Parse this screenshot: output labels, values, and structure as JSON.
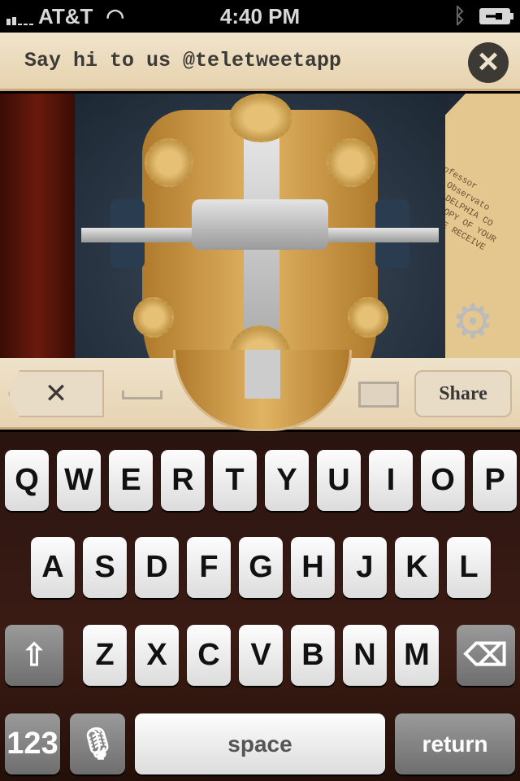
{
  "status": {
    "carrier": "AT&T",
    "time": "4:40 PM"
  },
  "banner": {
    "message": "Say hi to us @teletweetapp"
  },
  "paper_lines": [
    "Professor",
    "The Observato",
    "PHILADELPHIA CO",
    "HAVE COPY OF YOUR",
    "ME TO BE RECEIVE"
  ],
  "toolbar": {
    "share_label": "Share",
    "clear_glyph": "✕"
  },
  "keyboard": {
    "row1": [
      "Q",
      "W",
      "E",
      "R",
      "T",
      "Y",
      "U",
      "I",
      "O",
      "P"
    ],
    "row2": [
      "A",
      "S",
      "D",
      "F",
      "G",
      "H",
      "J",
      "K",
      "L"
    ],
    "row3": [
      "Z",
      "X",
      "C",
      "V",
      "B",
      "N",
      "M"
    ],
    "numbers_label": "123",
    "space_label": "space",
    "return_label": "return"
  }
}
